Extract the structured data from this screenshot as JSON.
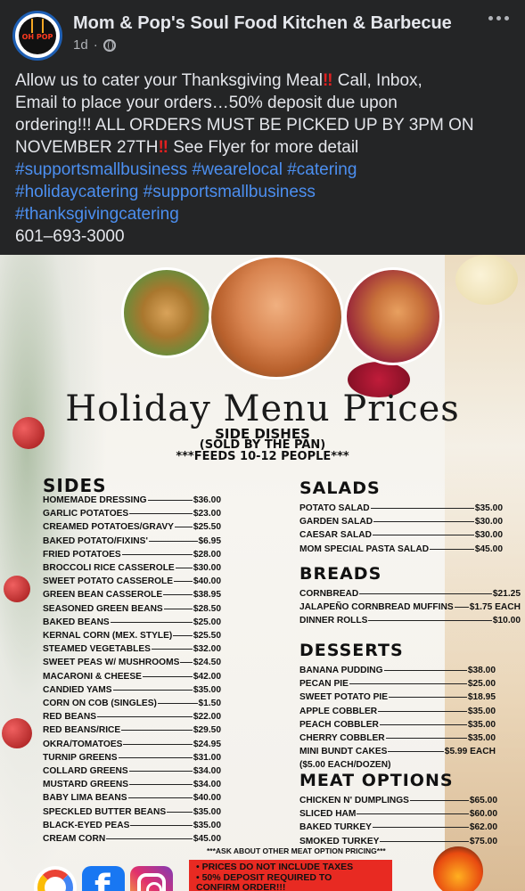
{
  "post": {
    "page_name": "Mom & Pop's Soul Food Kitchen & Barbecue",
    "time": "1d",
    "separator": "·",
    "avatar_text": "OH POP",
    "text_lines": [
      [
        "Allow us to cater your Thanksgiving Meal",
        "‼️",
        " Call, Inbox,"
      ],
      [
        "Email to place your orders…50% deposit due upon"
      ],
      [
        "ordering!!! ALL ORDERS MUST BE PICKED UP BY 3PM ON"
      ],
      [
        "NOVEMBER 27TH",
        "‼️",
        " See Flyer for more detail"
      ]
    ],
    "line1_a": "Allow us to cater your Thanksgiving Meal",
    "line1_bang": "‼",
    "line1_b": " Call, Inbox,",
    "line2": "Email to place your orders…50% deposit due upon",
    "line3": "ordering!!! ALL ORDERS MUST BE PICKED UP BY 3PM ON",
    "line4_a": "NOVEMBER 27TH",
    "line4_bang": "‼",
    "line4_b": " See Flyer for more detail",
    "hashtags": {
      "h1": "#supportsmallbusiness",
      "h2": "#wearelocal",
      "h3": "#catering",
      "h4": "#holidaycatering",
      "h5": "#supportsmallbusiness",
      "h6": "#thanksgivingcatering"
    },
    "phone": "601–693-3000"
  },
  "flyer": {
    "title": "Holiday Menu Prices",
    "subtitle1": "SIDE DISHES",
    "subtitle2": "(SOLD BY THE PAN)",
    "subtitle3": "***FEEDS 10-12 PEOPLE***",
    "sides": {
      "heading": "SIDES",
      "items": [
        {
          "name": "HOMEMADE DRESSING",
          "price": "$36.00"
        },
        {
          "name": "GARLIC POTATOES",
          "price": "$23.00"
        },
        {
          "name": "CREAMED POTATOES/GRAVY",
          "price": "$25.50"
        },
        {
          "name": "BAKED POTATO/FIXINS'",
          "price": "$6.95"
        },
        {
          "name": "FRIED POTATOES",
          "price": "$28.00"
        },
        {
          "name": "BROCCOLI RICE CASSEROLE",
          "price": "$30.00"
        },
        {
          "name": "SWEET POTATO CASSEROLE",
          "price": "$40.00"
        },
        {
          "name": "GREEN BEAN CASSEROLE",
          "price": "$38.95"
        },
        {
          "name": "SEASONED GREEN BEANS",
          "price": "$28.50"
        },
        {
          "name": "BAKED BEANS",
          "price": "$25.00"
        },
        {
          "name": "KERNAL CORN (MEX. STYLE)",
          "price": "$25.50"
        },
        {
          "name": "STEAMED VEGETABLES",
          "price": "$32.00"
        },
        {
          "name": "SWEET PEAS W/ MUSHROOMS",
          "price": "$24.50"
        },
        {
          "name": "MACARONI & CHEESE",
          "price": "$42.00"
        },
        {
          "name": "CANDIED YAMS",
          "price": "$35.00"
        },
        {
          "name": "CORN ON COB (SINGLES)",
          "price": "$1.50"
        },
        {
          "name": "RED BEANS",
          "price": "$22.00"
        },
        {
          "name": "RED BEANS/RICE",
          "price": "$29.50"
        },
        {
          "name": "OKRA/TOMATOES",
          "price": "$24.95"
        },
        {
          "name": "TURNIP GREENS",
          "price": "$31.00"
        },
        {
          "name": "COLLARD GREENS",
          "price": "$34.00"
        },
        {
          "name": "MUSTARD GREENS",
          "price": "$34.00"
        },
        {
          "name": "BABY LIMA BEANS",
          "price": "$40.00"
        },
        {
          "name": "SPECKLED BUTTER BEANS",
          "price": "$35.00"
        },
        {
          "name": "BLACK-EYED PEAS",
          "price": "$35.00"
        },
        {
          "name": "CREAM CORN",
          "price": "$45.00"
        }
      ]
    },
    "salads": {
      "heading": "SALADS",
      "items": [
        {
          "name": "POTATO SALAD",
          "price": "$35.00"
        },
        {
          "name": "GARDEN SALAD",
          "price": "$30.00"
        },
        {
          "name": "CAESAR SALAD",
          "price": "$30.00"
        },
        {
          "name": "MOM SPECIAL PASTA SALAD",
          "price": "$45.00"
        }
      ]
    },
    "breads": {
      "heading": "BREADS",
      "items": [
        {
          "name": "CORNBREAD",
          "price": "$21.25"
        },
        {
          "name": "JALAPEÑO CORNBREAD MUFFINS",
          "price": "$1.75 EACH"
        },
        {
          "name": "DINNER ROLLS",
          "price": "$10.00"
        }
      ]
    },
    "desserts": {
      "heading": "DESSERTS",
      "items": [
        {
          "name": "BANANA PUDDING",
          "price": "$38.00"
        },
        {
          "name": "PECAN PIE",
          "price": "$25.00"
        },
        {
          "name": "SWEET POTATO PIE",
          "price": "$18.95"
        },
        {
          "name": "APPLE COBBLER",
          "price": "$35.00"
        },
        {
          "name": "PEACH COBBLER",
          "price": "$35.00"
        },
        {
          "name": "CHERRY COBBLER",
          "price": "$35.00"
        },
        {
          "name": "MINI BUNDT CAKES",
          "price": "$5.99 EACH"
        }
      ],
      "note": "($5.00 EACH/DOZEN)"
    },
    "meat": {
      "heading": "MEAT OPTIONS",
      "items": [
        {
          "name": "CHICKEN N' DUMPLINGS",
          "price": "$65.00"
        },
        {
          "name": "SLICED HAM",
          "price": "$60.00"
        },
        {
          "name": "BAKED TURKEY",
          "price": "$62.00"
        },
        {
          "name": "SMOKED TURKEY",
          "price": "$75.00"
        }
      ]
    },
    "footnote": "***ASK ABOUT OTHER MEAT OPTION PRICING***",
    "notice_lines": [
      "•  PRICES DO NOT INCLUDE TAXES",
      "•  50% DEPOSIT REQUIRED TO",
      "    CONFIRM ORDER!!!"
    ],
    "colors": {
      "accent_red": "#e82a22",
      "hashtag_blue": "#4c8ff0",
      "background": "#242526"
    }
  }
}
